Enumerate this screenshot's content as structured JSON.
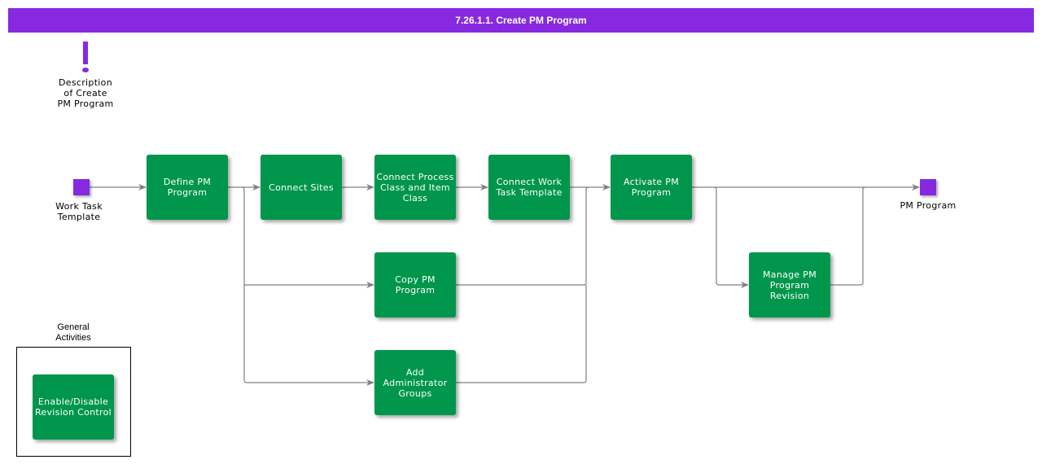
{
  "header": {
    "title": "7.26.1.1. Create PM Program"
  },
  "colors": {
    "header": "#8629e0",
    "activity": "#00964b",
    "event": "#8629e0",
    "connector": "#808080"
  },
  "note": {
    "icon": "exclamation-icon",
    "label": "Description\nof Create\nPM Program"
  },
  "events": {
    "start": {
      "label": "Work Task\nTemplate"
    },
    "end": {
      "label": "PM Program"
    }
  },
  "activities": {
    "define": "Define PM Program",
    "connect_sites": "Connect Sites",
    "connect_process": "Connect Process Class and Item Class",
    "connect_work_task": "Connect Work Task Template",
    "activate": "Activate PM Program",
    "copy": "Copy PM Program",
    "add_admin": "Add Administrator Groups",
    "manage_revision": "Manage PM Program Revision"
  },
  "general_activities": {
    "label": "General\nActivities",
    "items": [
      "Enable/Disable Revision Control"
    ]
  }
}
